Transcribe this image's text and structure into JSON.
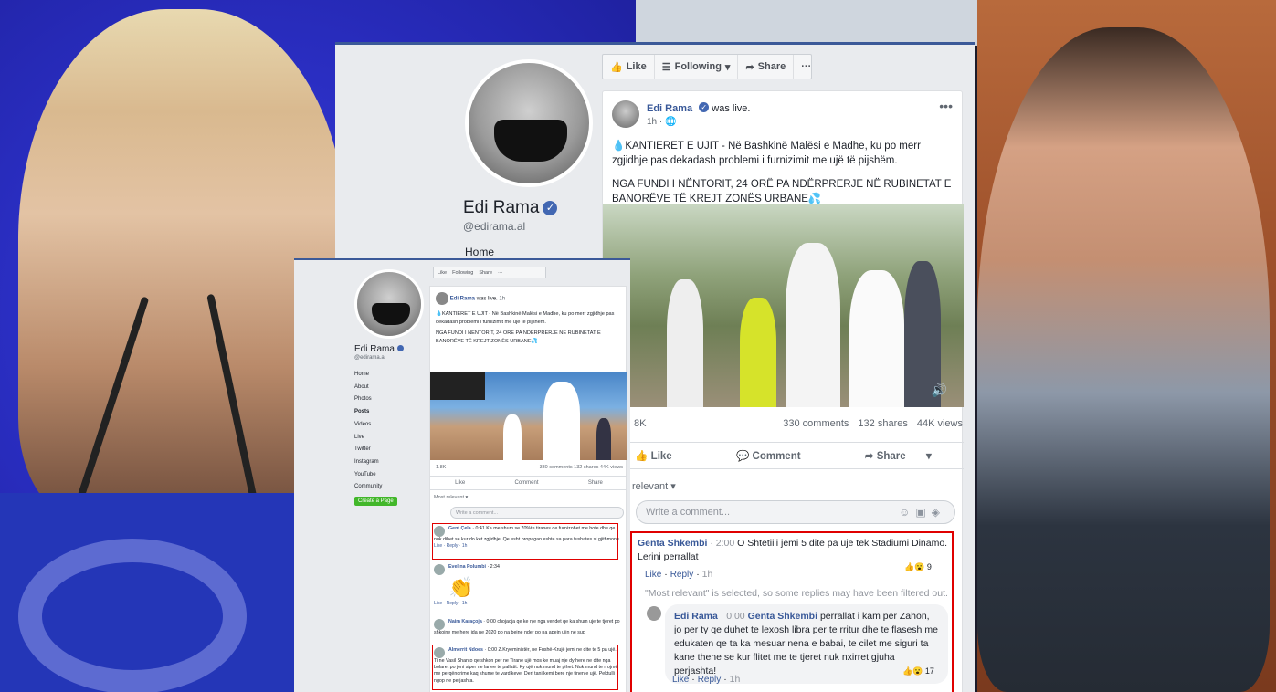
{
  "big_page": {
    "page_name": "Edi Rama",
    "handle": "@edirama.al",
    "nav_home": "Home",
    "actionbar": {
      "like": "Like",
      "following": "Following",
      "share": "Share",
      "more": "···"
    },
    "post": {
      "author": "Edi Rama",
      "was_live": "was live.",
      "time": "1h",
      "text1": "💧KANTIERET E UJIT - Në Bashkinë Malësi e Madhe, ku po merr zgjidhje pas dekadash problemi i furnizimit me ujë të pijshëm.",
      "text2": "NGA FUNDI I NËNTORIT, 24 ORË PA NDËRPRERJE NË RUBINETAT E BANORËVE TË KREJT ZONËS URBANE💦",
      "reactions": "8K",
      "comments_count": "330 comments",
      "shares_count": "132 shares",
      "views_count": "44K views",
      "btn_like": "Like",
      "btn_comment": "Comment",
      "btn_share": "Share",
      "relevant": "relevant ▾",
      "comment_placeholder": "Write a comment...",
      "comments": [
        {
          "name": "Genta Shkembi",
          "meta": "· 2:00",
          "text": "O Shtetiiii jemi 5 dite pa uje tek Stadiumi Dinamo. Lerini perrallat",
          "like": "Like",
          "reply": "Reply",
          "time": "1h",
          "react": "9"
        },
        {
          "note": "\"Most relevant\" is selected, so some replies may have been filtered out."
        },
        {
          "name": "Edi Rama",
          "meta": "· 0:00",
          "mention": "Genta Shkembi",
          "text": "perrallat i kam per Zahon, jo per ty qe duhet te lexosh libra per te rritur dhe te flasesh me edukaten qe ta ka mesuar nena e babai, te cilet me siguri ta kane thene se kur flitet me te tjeret nuk nxirret gjuha perjashta!",
          "like": "Like",
          "reply": "Reply",
          "time": "1h",
          "react": "17"
        }
      ]
    }
  },
  "small_page": {
    "page_name": "Edi Rama",
    "handle": "@edirama.al",
    "nav": [
      "Home",
      "About",
      "Photos",
      "Posts",
      "Videos",
      "Live",
      "Twitter",
      "Instagram",
      "YouTube",
      "Community"
    ],
    "create_page": "Create a Page",
    "actionbar": {
      "like": "Like",
      "following": "Following",
      "share": "Share",
      "more": "···"
    },
    "post": {
      "author": "Edi Rama",
      "was_live": "was live.",
      "time": "1h",
      "text1": "💧KANTIERET E UJIT - Në Bashkinë Malësi e Madhe, ku po merr zgjidhje pas dekadash problemi i furnizimit me ujë të pijshëm.",
      "text2": "NGA FUNDI I NËNTORIT, 24 ORË PA NDËRPRERJE NË RUBINETAT E BANORËVE TË KREJT ZONËS URBANE💦",
      "reactions": "1.8K",
      "comments_count": "330 comments",
      "shares_count": "132 shares",
      "views_count": "44K views",
      "btn_like": "Like",
      "btn_comment": "Comment",
      "btn_share": "Share",
      "relevant": "Most relevant ▾",
      "comment_placeholder": "Write a comment...",
      "comments": [
        {
          "name": "Gent Çela",
          "meta": "· 0:41",
          "text": "Ka me shum se 70%te tiranes qe furnizohet me bote dhe qe nuk dihet se kur do ket zgjidhje. Qe esht propagan eshte sa para fushates si gjithmone",
          "links": "Like · Reply · 1h"
        },
        {
          "name": "Evelina Polumbi",
          "meta": "· 2:34",
          "text": "👏",
          "links": "Like · Reply · 1h"
        },
        {
          "name": "Naim Karaçoja",
          "meta": "· 0:00",
          "text": "chojaoja qe ke nje nga vendet qe ka shum uje te tjeret po shkojne me here ida ne 2020 po na bejne nder po na apein ujin ne sup",
          "links": "Like · Reply · 1h"
        },
        {
          "name": "Almerrit Ndoes",
          "meta": "· 0:00",
          "text": "Z.Kryeministër, ne Fushë-Krujë jemi ne dite te 5 pa ujë. Ti ne Vasil Shanto qe shkon per ne Tirane ujë mos ke muaj nje dy here ne dite nga bolaret po jeni siper ne lanee te pallatit. Ky ujë nuk mund te pihet. Nuk mund te rrojmë me perqëndrime kaq shume te vardikeve. Deri tani kemi bere nje tinen e ujë. Pektulli ngop ne perjashta.",
          "links": "Like · Reply · 1h"
        }
      ]
    }
  }
}
